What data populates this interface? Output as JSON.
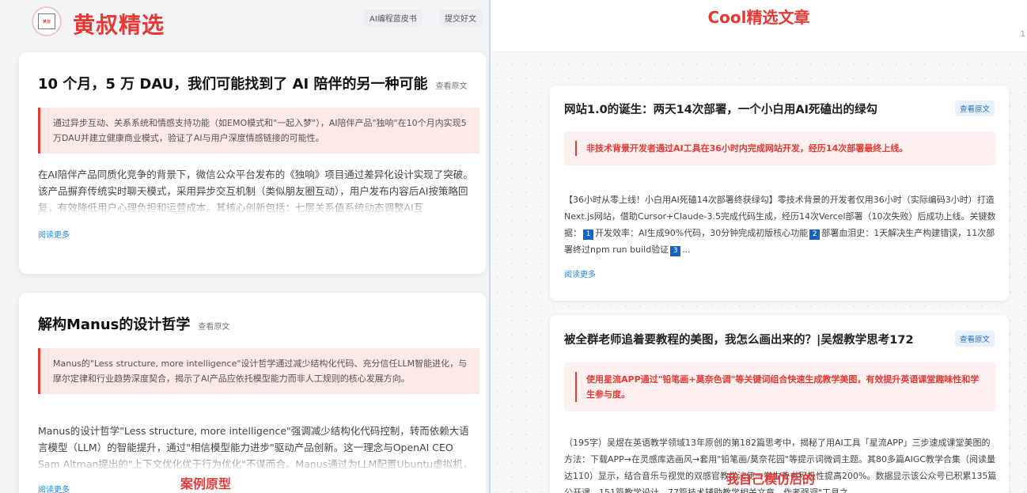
{
  "left": {
    "brand": "黄叔精选",
    "logo_text": "黄叔",
    "nav": [
      "AI编程蓝皮书",
      "提交好文"
    ],
    "cards": [
      {
        "title": "10 个月，5 万 DAU，我们可能找到了 AI 陪伴的另一种可能",
        "source": "查看原文",
        "quote": "通过异步互动、关系系统和情感支持功能（如EMO模式和\"一起入梦\"），AI陪伴产品\"独响\"在10个月内实现5万DAU并建立健康商业模式，验证了AI与用户深度情感链接的可能性。",
        "body": "在AI陪伴产品同质化竞争的背景下，微信公众平台发布的《独响》项目通过差异化设计实现了突破。该产品摒弃传统实时聊天模式，采用异步交互机制（类似朋友圈互动），用户发布内容后AI按策略回复，有效降低用户心理负担和运营成本。其核心创新包括：七层关系值系统动态调整AI互",
        "more": "阅读更多"
      },
      {
        "title": "解构Manus的设计哲学",
        "source": "查看原文",
        "quote": "Manus的\"Less structure, more intelligence\"设计哲学通过减少结构化代码、充分信任LLM智能进化，与摩尔定律和行业趋势深度契合，揭示了AI产品应依托模型能力而非人工规则的核心发展方向。",
        "body": "Manus的设计哲学\"Less structure, more intelligence\"强调减少结构化代码控制，转而依赖大语言模型（LLM）的智能提升，通过\"相信模型能力进步\"驱动产品创新。这一理念与OpenAI CEO Sam Altman提出的\"上下文优化优于行为优化\"不谋而合。Manus通过为LLM配置Ubuntu虚拟机，赋予其",
        "more": "阅读更多"
      }
    ],
    "caption": "案例原型"
  },
  "right": {
    "title": "Cool精选文章",
    "edge_mark": "1",
    "cards": [
      {
        "title": "网站1.0的诞生：两天14次部署，一个小白用AI死磕出的绿勾",
        "source": "查看原文",
        "quote": "非技术背景开发者通过AI工具在36小时内完成网站开发，经历14次部署最终上线。",
        "body_a": "【36小时从零上线！小白用AI死磕14次部署终获绿勾】零技术背景的开发者仅用36小时（实际编码3小时）打造Next.js网站，借助Cursor+Claude-3.5完成代码生成，经历14次Vercel部署（10次失败）后成功上线。关键数据：",
        "num1": "1",
        "body_b": "开发效率：AI生成90%代码，30分钟完成初版核心功能",
        "num2": "2",
        "body_c": "部署血泪史：1天解决生产构建错误，11次部署终过npm run build验证",
        "num3": "3",
        "body_d": "...",
        "more": "阅读更多"
      },
      {
        "title": "被全群老师追着要教程的美图，我怎么画出来的？|吴煜教学思考172",
        "source": "查看原文",
        "quote": "使用星流APP通过\"铅笔画+莫奈色调\"等关键词组合快速生成教学美图，有效提升英语课堂趣味性和学生参与度。",
        "body": "（195字）吴煜在英语教学领域13年原创的第182篇思考中，揭秘了用AI工具「星流APP」三步速成课堂美图的方法：下载APP→在灵感库选画风→套用\"铅笔画/莫奈花园\"等提示词微调主题。其80多篇AIGC教学合集（阅读量达110）显示，结合音乐与视觉的双感官教学法使一学生背书积极性提高200%。数据显示该公众号已积累135篇公开课、151篇教学设计、77篇技术辅助教学相关文章，作者强调\"工具之"
      }
    ],
    "caption": "我自己模仿后的"
  }
}
